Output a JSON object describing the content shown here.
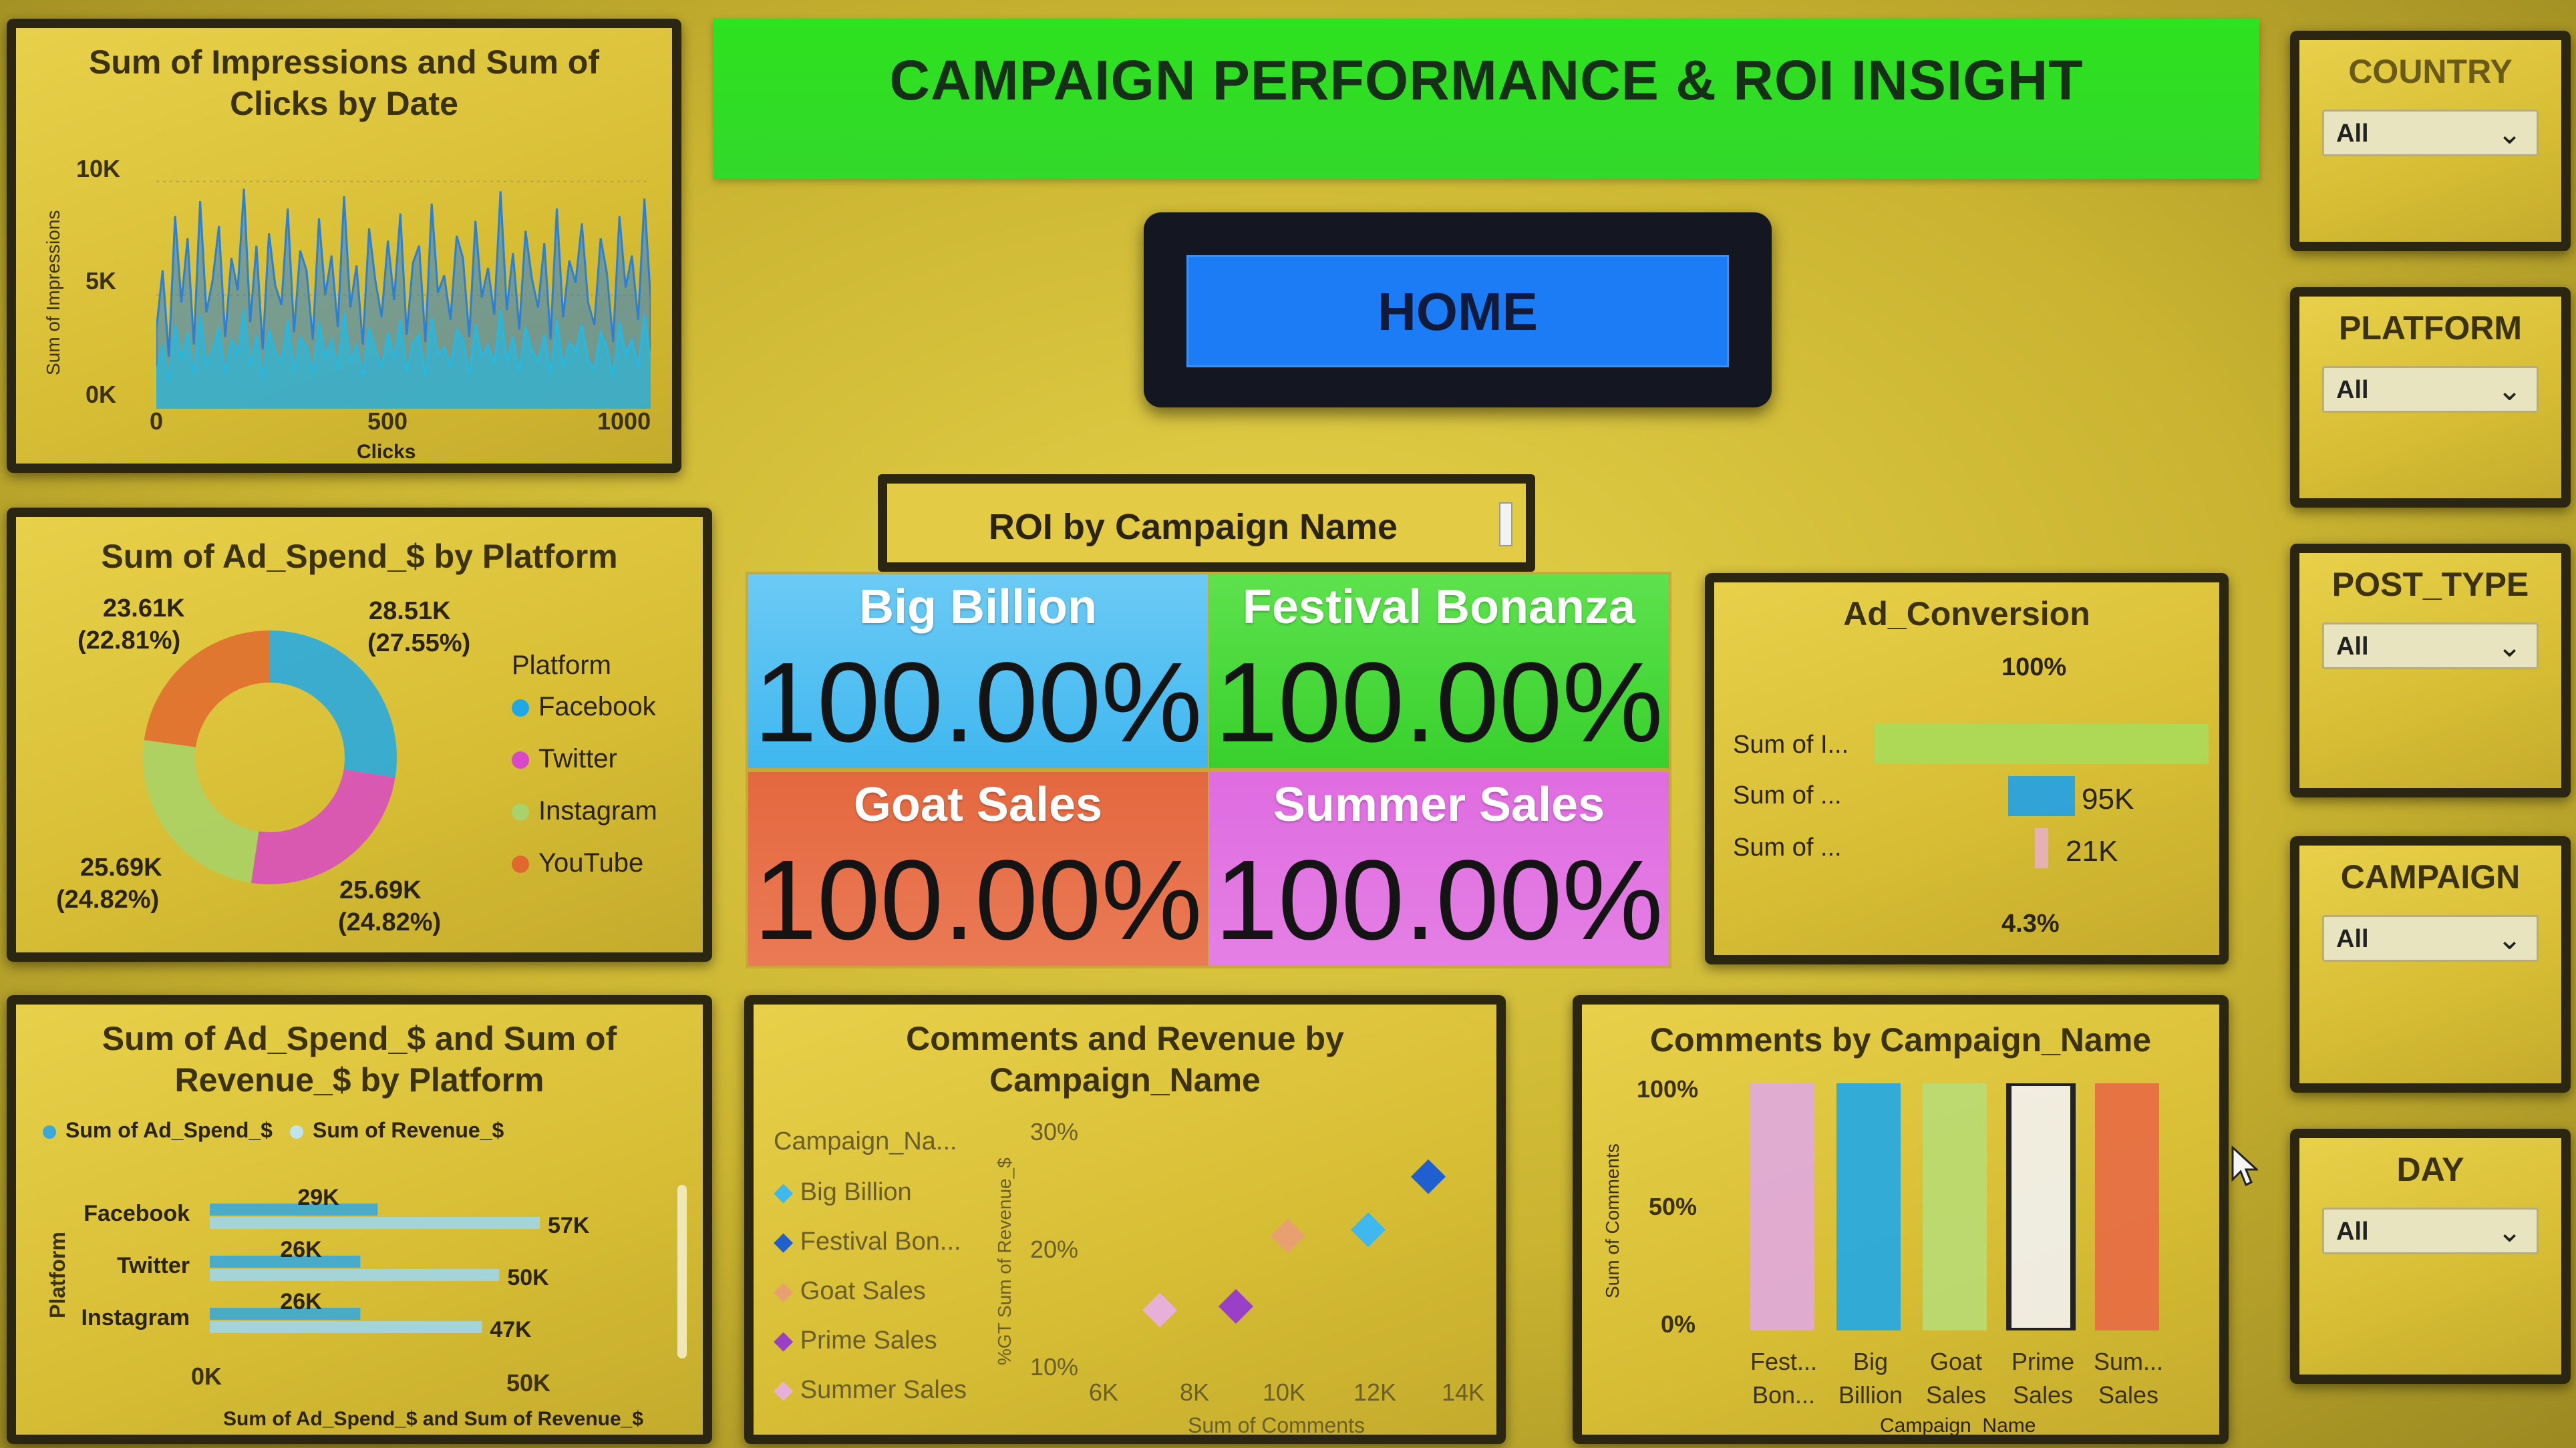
{
  "header": {
    "title": "CAMPAIGN PERFORMANCE & ROI INSIGHT"
  },
  "home_button": {
    "label": "HOME"
  },
  "roi_card": {
    "title": "ROI by Campaign Name"
  },
  "kpis": [
    {
      "name": "Big Billion",
      "value": "100.00%",
      "color": "#3fb7ef"
    },
    {
      "name": "Festival Bonanza",
      "value": "100.00%",
      "color": "#3ed43a"
    },
    {
      "name": "Goat Sales",
      "value": "100.00%",
      "color": "#e86a45"
    },
    {
      "name": "Summer Sales",
      "value": "100.00%",
      "color": "#e06fe0"
    }
  ],
  "slicers": [
    {
      "title": "COUNTRY",
      "value": "All"
    },
    {
      "title": "PLATFORM",
      "value": "All"
    },
    {
      "title": "POST_TYPE",
      "value": "All"
    },
    {
      "title": "CAMPAIGN",
      "value": "All"
    },
    {
      "title": "DAY",
      "value": "All"
    }
  ],
  "icons": {
    "chevron": "chevron-down-icon",
    "cursor": "mouse-pointer-icon"
  },
  "colors": {
    "header_green": "#2ee21f",
    "home_blue": "#1b7cf5",
    "facebook": "#1fa8e8",
    "twitter": "#d948c8",
    "instagram": "#a7d36a",
    "youtube": "#e0682e"
  },
  "chart_data": [
    {
      "type": "area",
      "title": "Sum of Impressions and Sum of Clicks by Date",
      "xlabel": "Clicks",
      "ylabel": "Sum of Impressions",
      "x_ticks": [
        "0",
        "500",
        "1000"
      ],
      "y_ticks": [
        "0K",
        "5K",
        "10K"
      ],
      "xlim": [
        0,
        1000
      ],
      "ylim": [
        0,
        10000
      ],
      "series": [
        {
          "name": "Sum of Impressions",
          "values": [
            3200,
            5600,
            2100,
            7800,
            4300,
            6900,
            2600,
            8400,
            3900,
            5200,
            7400,
            2900,
            6100,
            4800,
            8900,
            3500,
            6600,
            2400,
            7100,
            5000,
            4200,
            8100,
            3100,
            6400,
            5600,
            2800,
            7700,
            4600,
            6200,
            3300,
            8600,
            4100,
            5800,
            2600,
            7300,
            5200,
            3700,
            6800,
            4400,
            7900,
            3000,
            5900,
            6600,
            2700,
            8300,
            4700,
            5400,
            3600,
            7000,
            6100,
            2900,
            7600,
            4500,
            5700,
            3800,
            8800,
            4000,
            6300,
            3200,
            7200,
            5300,
            4100,
            6700,
            2800,
            8100,
            3700,
            6000,
            5100,
            7500,
            4300,
            3400,
            6900,
            5500,
            2700,
            7800,
            4900,
            6200,
            3600,
            8500,
            4400
          ]
        },
        {
          "name": "Sum of Clicks",
          "values": [
            1500,
            2600,
            1100,
            3400,
            2000,
            3100,
            1300,
            3800,
            1800,
            2400,
            3300,
            1400,
            2800,
            2200,
            4000,
            1700,
            3000,
            1200,
            3200,
            2300,
            1900,
            3600,
            1500,
            2900,
            2500,
            1400,
            3500,
            2100,
            2800,
            1600,
            3900,
            1900,
            2600,
            1300,
            3300,
            2400,
            1700,
            3100,
            2000,
            3600,
            1500,
            2700,
            3000,
            1300,
            3700,
            2200,
            2500,
            1700,
            3200,
            2800,
            1400,
            3400,
            2100,
            2600,
            1800,
            4000,
            1900,
            2900,
            1500,
            3300,
            2400,
            1900,
            3000,
            1400,
            3600,
            1700,
            2700,
            2300,
            3400,
            2000,
            1600,
            3100,
            2500,
            1300,
            3500,
            2200,
            2800,
            1700,
            3800,
            2000
          ]
        }
      ]
    },
    {
      "type": "pie",
      "title": "Sum of Ad_Spend_$ by Platform",
      "legend_title": "Platform",
      "legend_position": "right",
      "categories": [
        "Facebook",
        "Twitter",
        "Instagram",
        "YouTube"
      ],
      "values": [
        28.51,
        25.69,
        25.69,
        23.61
      ],
      "labels": [
        {
          "value": "28.51K",
          "pct": "(27.55%)"
        },
        {
          "value": "25.69K",
          "pct": "(24.82%)"
        },
        {
          "value": "25.69K",
          "pct": "(24.82%)"
        },
        {
          "value": "23.61K",
          "pct": "(22.81%)"
        }
      ]
    },
    {
      "type": "bar",
      "orientation": "horizontal",
      "title": "Sum of Ad_Spend_$ and Sum of Revenue_$ by Platform",
      "xlabel": "Sum of Ad_Spend_$ and Sum of Revenue_$",
      "ylabel": "Platform",
      "x_ticks": [
        "0K",
        "50K"
      ],
      "xlim": [
        0,
        60
      ],
      "categories": [
        "Facebook",
        "Twitter",
        "Instagram"
      ],
      "series": [
        {
          "name": "Sum of Ad_Spend_$",
          "values": [
            29,
            26,
            26
          ],
          "labels": [
            "29K",
            "26K",
            "26K"
          ]
        },
        {
          "name": "Sum of Revenue_$",
          "values": [
            57,
            50,
            47
          ],
          "labels": [
            "57K",
            "50K",
            "47K"
          ]
        }
      ]
    },
    {
      "type": "scatter",
      "title": "Comments and Revenue by Campaign_Name",
      "legend_title": "Campaign_Na...",
      "xlabel": "Sum of Comments",
      "ylabel": "%GT Sum of Revenue_$",
      "x_ticks": [
        "6K",
        "8K",
        "10K",
        "12K",
        "14K"
      ],
      "y_ticks": [
        "10%",
        "20%",
        "30%"
      ],
      "xlim": [
        5000,
        15000
      ],
      "ylim": [
        10,
        30
      ],
      "series": [
        {
          "name": "Big Billion",
          "x": [
            12000
          ],
          "y": [
            21.5
          ],
          "color": "#3fb7ef"
        },
        {
          "name": "Festival Bon...",
          "x": [
            13500
          ],
          "y": [
            25.8
          ],
          "color": "#1f5fd0"
        },
        {
          "name": "Goat Sales",
          "x": [
            10000
          ],
          "y": [
            21.0
          ],
          "color": "#e8a070"
        },
        {
          "name": "Prime Sales",
          "x": [
            8700
          ],
          "y": [
            15.3
          ],
          "color": "#9a3fc8"
        },
        {
          "name": "Summer Sales",
          "x": [
            6800
          ],
          "y": [
            15.0
          ],
          "color": "#e6b0d8"
        }
      ]
    },
    {
      "type": "bar",
      "title": "Comments by Campaign_Name",
      "xlabel": "Campaign_Name",
      "ylabel": "Sum of Comments",
      "y_ticks": [
        "0%",
        "50%",
        "100%"
      ],
      "ylim": [
        0,
        100
      ],
      "categories": [
        "Fest... Bon...",
        "Big Billion",
        "Goat Sales",
        "Prime Sales",
        "Sum... Sales"
      ],
      "values": [
        100,
        100,
        100,
        100,
        100
      ],
      "colors": [
        "#e0a8e0",
        "#1fa8e8",
        "#b8dc74",
        "#f2f2f2",
        "#e86a45"
      ]
    },
    {
      "type": "bar",
      "orientation": "funnel",
      "title": "Ad_Conversion",
      "top_label": "100%",
      "bottom_label": "4.3%",
      "categories": [
        "Sum of I...",
        "Sum of ...",
        "Sum of ..."
      ],
      "values": [
        100,
        95,
        21
      ],
      "labels": [
        "",
        "95K",
        "21K"
      ]
    }
  ]
}
